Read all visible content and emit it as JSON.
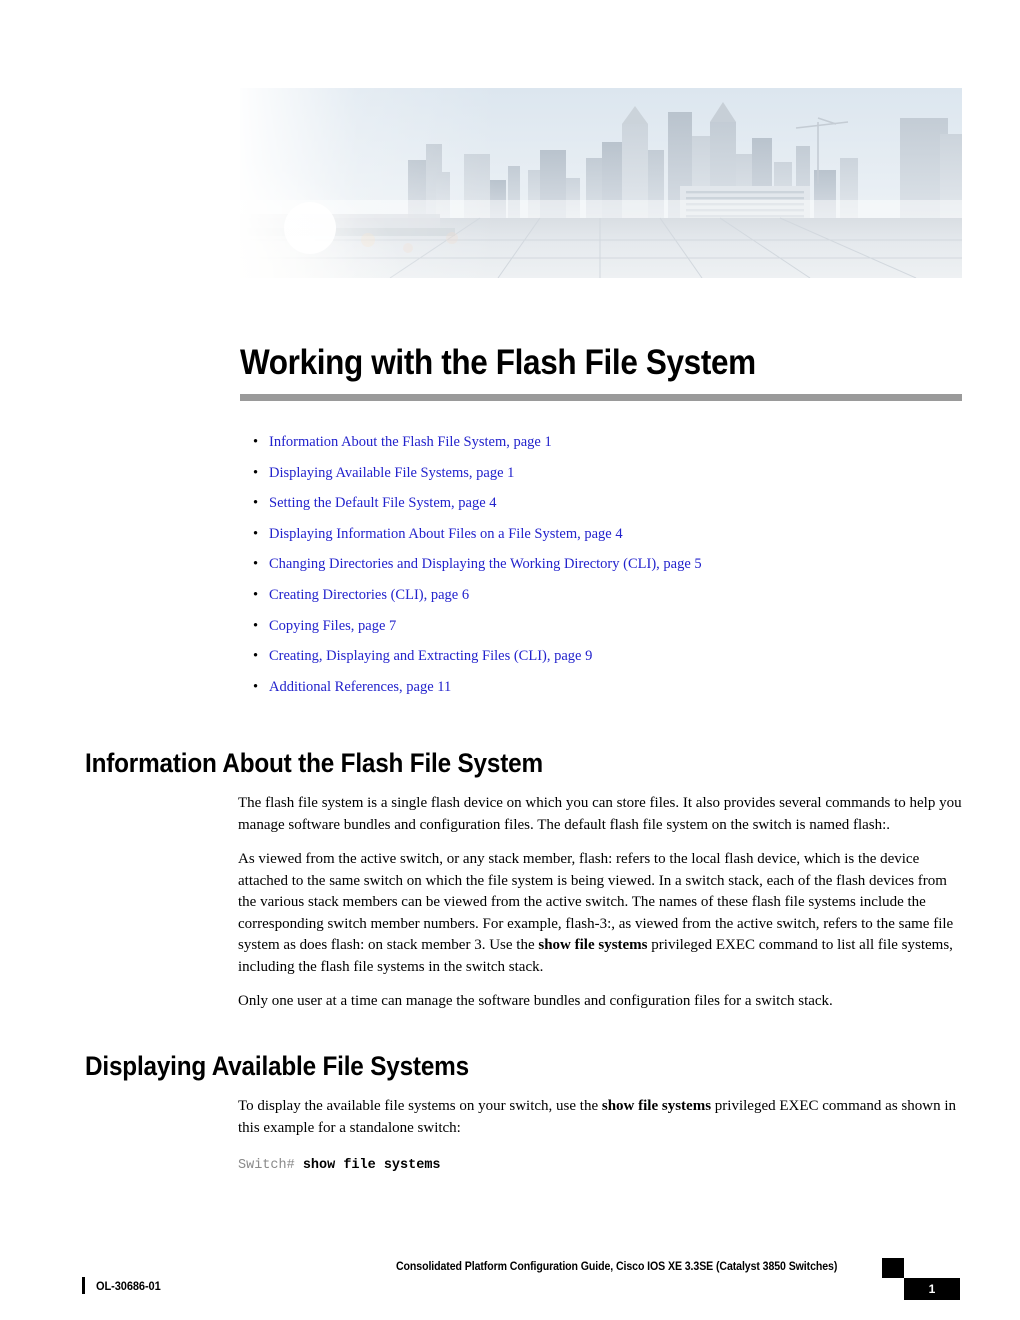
{
  "banner": {
    "alt": "city-skyline-banner",
    "description": "Washed out cityscape with sun flare at left, skyscrapers and reflective plaza"
  },
  "chapter": {
    "title": "Working with the Flash File System"
  },
  "toc": {
    "bullet": "•",
    "items": [
      {
        "label": "Information About the Flash File System,  page  1"
      },
      {
        "label": "Displaying Available File Systems,  page  1"
      },
      {
        "label": "Setting the Default File System,  page  4"
      },
      {
        "label": "Displaying Information About Files on a File System,  page  4"
      },
      {
        "label": "Changing Directories and Displaying the Working Directory (CLI),  page  5"
      },
      {
        "label": "Creating Directories (CLI),  page  6"
      },
      {
        "label": "Copying Files,  page  7"
      },
      {
        "label": "Creating, Displaying and Extracting Files (CLI),  page  9"
      },
      {
        "label": "Additional References,  page  11"
      }
    ]
  },
  "sections": {
    "information": {
      "heading": "Information About the Flash File System",
      "para1": "The flash file system is a single flash device on which you can store files. It also provides several commands to help you manage software bundles and configuration files. The default flash file system on the switch is named flash:.",
      "para2_part1": "As viewed from the active switch, or any stack member, flash: refers to the local flash device, which is the device attached to the same switch on which the file system is being viewed. In a switch stack, each of the flash devices from the various stack members can be viewed from the active switch. The names of these flash file systems include the corresponding switch member numbers. For example, flash-3:, as viewed from the active switch, refers to the same file system as does flash: on stack member 3. Use the ",
      "para2_bold": "show file systems",
      "para2_part2": " privileged EXEC command to list all file systems, including the flash file systems in the switch stack.",
      "para3": "Only one user at a time can manage the software bundles and configuration files for a switch stack."
    },
    "displaying": {
      "heading": "Displaying Available File Systems",
      "para1_part1": "To display the available file systems on your switch, use the ",
      "para1_bold": "show file systems",
      "para1_part2": " privileged EXEC command as shown in this example for a standalone switch:",
      "code_prompt": "Switch# ",
      "code_command": "show file systems"
    }
  },
  "footer": {
    "guide_title": "Consolidated Platform Configuration Guide, Cisco IOS XE 3.3SE (Catalyst 3850 Switches)",
    "doc_id": "OL-30686-01",
    "page_number": "1"
  },
  "colors": {
    "link": "#2222cc",
    "rule": "#9a9a9a",
    "prompt": "#8a8a8a",
    "footer_box": "#000000"
  }
}
